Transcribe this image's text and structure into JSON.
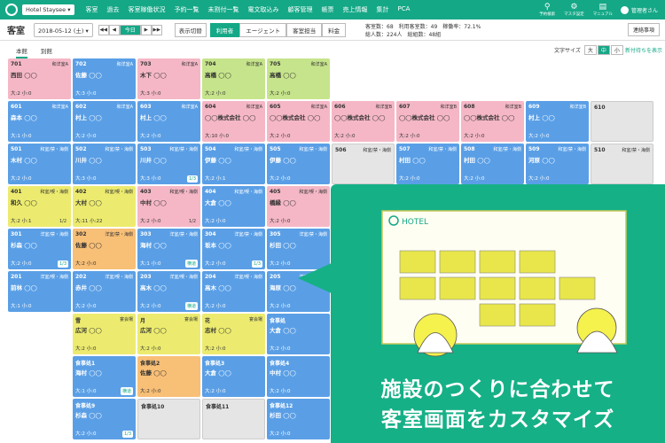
{
  "nav": {
    "hotel": "Hotel Staysee",
    "items": [
      "客室",
      "過去",
      "客室稼働状況",
      "予約一覧",
      "未割付一覧",
      "電文取込み",
      "顧客管理",
      "帳票",
      "売上情報",
      "集計",
      "PCA"
    ],
    "icons": [
      {
        "icon": "search-icon",
        "label": "予約検索"
      },
      {
        "icon": "gear-icon",
        "label": "マスタ設定"
      },
      {
        "icon": "book-icon",
        "label": "マニュアル"
      }
    ],
    "user": "管理者さん"
  },
  "toolbar": {
    "title": "客室",
    "date": "2018-05-12 (土)",
    "prev2": "◀◀",
    "prev": "◀",
    "today": "今日",
    "next": "▶",
    "next2": "▶▶",
    "switch_label": "表示切替",
    "segments": [
      "利用者",
      "エージェント",
      "客室担当",
      "料金"
    ],
    "stats_line1": "客室数：68　利用客室数：49　稼働率：72.1%",
    "stats_line2": "総人数：224人　総組数：48組",
    "contact": "連絡事項"
  },
  "view": {
    "tabs": [
      "本館",
      "別館"
    ],
    "font_label": "文字サイズ",
    "font_sizes": [
      "大",
      "中",
      "小"
    ],
    "new_link": "新付待ちを表示"
  },
  "rows": [
    {
      "y": 0,
      "cells": [
        {
          "c": 0,
          "room": "701",
          "type": "和洋室A",
          "guest": "西田",
          "count": "大:2 小:0",
          "color": "p"
        },
        {
          "c": 1,
          "room": "702",
          "type": "和洋室A",
          "guest": "佐藤",
          "count": "大:3 小:0",
          "color": "b"
        },
        {
          "c": 2,
          "room": "703",
          "type": "和洋室A",
          "guest": "木下",
          "count": "大:3 小:0",
          "color": "p"
        },
        {
          "c": 3,
          "room": "704",
          "type": "和洋室A",
          "guest": "高橋",
          "count": "大:2 小:0",
          "color": "g"
        },
        {
          "c": 4,
          "room": "705",
          "type": "和洋室A",
          "guest": "高橋",
          "count": "大:2 小:0",
          "color": "g"
        }
      ]
    },
    {
      "y": 1,
      "cells": [
        {
          "c": 0,
          "room": "601",
          "type": "和洋室A",
          "guest": "森本",
          "count": "大:1 小:0",
          "color": "b"
        },
        {
          "c": 1,
          "room": "602",
          "type": "和洋室A",
          "guest": "村上",
          "count": "大:2 小:0",
          "color": "b"
        },
        {
          "c": 2,
          "room": "603",
          "type": "和洋室A",
          "guest": "村上",
          "count": "大:2 小:0",
          "color": "b"
        },
        {
          "c": 3,
          "room": "604",
          "type": "和洋室A",
          "guest": "◯◯株式会社",
          "count": "大:10 小:0",
          "color": "p"
        },
        {
          "c": 4,
          "room": "605",
          "type": "和洋室A",
          "guest": "◯◯株式会社",
          "count": "大:2 小:0",
          "color": "p"
        },
        {
          "c": 5,
          "room": "606",
          "type": "和洋室B",
          "guest": "◯◯株式会社",
          "count": "大:2 小:0",
          "color": "p"
        },
        {
          "c": 6,
          "room": "607",
          "type": "和洋室B",
          "guest": "◯◯株式会社",
          "count": "大:2 小:0",
          "color": "p"
        },
        {
          "c": 7,
          "room": "608",
          "type": "和洋室B",
          "guest": "◯◯株式会社",
          "count": "大:2 小:0",
          "color": "p"
        },
        {
          "c": 8,
          "room": "609",
          "type": "和洋室B",
          "guest": "村上",
          "count": "大:2 小:0",
          "color": "b"
        },
        {
          "c": 9,
          "room": "610",
          "type": "",
          "guest": "",
          "count": "",
          "color": "gr"
        }
      ]
    },
    {
      "y": 2,
      "cells": [
        {
          "c": 0,
          "room": "501",
          "type": "和室/禁・海側",
          "guest": "木村",
          "count": "大:2 小:0",
          "color": "b"
        },
        {
          "c": 1,
          "room": "502",
          "type": "和室/禁・海側",
          "guest": "川井",
          "count": "大:3 小:0",
          "color": "b"
        },
        {
          "c": 2,
          "room": "503",
          "type": "和室/禁・海側",
          "guest": "川井",
          "count": "大:3 小:0",
          "color": "b",
          "badge": "1/3"
        },
        {
          "c": 3,
          "room": "504",
          "type": "和室/禁・海側",
          "guest": "伊藤",
          "count": "大:2 小:1",
          "color": "b"
        },
        {
          "c": 4,
          "room": "505",
          "type": "和室/禁・海側",
          "guest": "伊藤",
          "count": "大:2 小:0",
          "color": "b"
        },
        {
          "c": 5,
          "room": "506",
          "type": "和室/禁・海側",
          "guest": "",
          "count": "",
          "color": "gr"
        },
        {
          "c": 6,
          "room": "507",
          "type": "和室/禁・海側",
          "guest": "村田",
          "count": "大:2 小:0",
          "color": "b"
        },
        {
          "c": 7,
          "room": "508",
          "type": "和室/禁・海側",
          "guest": "村田",
          "count": "大:2 小:0",
          "color": "b"
        },
        {
          "c": 8,
          "room": "509",
          "type": "和室/禁・海側",
          "guest": "河原",
          "count": "大:2 小:0",
          "color": "b"
        },
        {
          "c": 9,
          "room": "510",
          "type": "和室/禁・海側",
          "guest": "",
          "count": "",
          "color": "gr"
        }
      ]
    },
    {
      "y": 3,
      "cells": [
        {
          "c": 0,
          "room": "401",
          "type": "和室/喫・海側",
          "guest": "和久",
          "count": "大:2 小:1",
          "color": "y",
          "badge": "1/2"
        },
        {
          "c": 1,
          "room": "402",
          "type": "和室/喫・海側",
          "guest": "大村",
          "count": "大:11 小:22",
          "color": "y"
        },
        {
          "c": 2,
          "room": "403",
          "type": "和室/喫・海側",
          "guest": "中村",
          "count": "大:2 小:0",
          "color": "p",
          "badge": "1/2"
        },
        {
          "c": 3,
          "room": "404",
          "type": "和室/喫・海側",
          "guest": "大倉",
          "count": "大:2 小:0",
          "color": "b"
        },
        {
          "c": 4,
          "room": "405",
          "type": "和室/喫・海側",
          "guest": "橋縁",
          "count": "大:2 小:0",
          "color": "p"
        }
      ]
    },
    {
      "y": 4,
      "cells": [
        {
          "c": 0,
          "room": "301",
          "type": "洋室/禁・海側",
          "guest": "杉森",
          "count": "大:2 小:0",
          "color": "b",
          "badge": "1/3"
        },
        {
          "c": 1,
          "room": "302",
          "type": "洋室/禁・海側",
          "guest": "佐藤",
          "count": "大:2 小:0",
          "color": "o"
        },
        {
          "c": 2,
          "room": "303",
          "type": "洋室/禁・海側",
          "guest": "海村",
          "count": "大:1 小:0",
          "color": "b",
          "badge": "横道"
        },
        {
          "c": 3,
          "room": "304",
          "type": "洋室/禁・海側",
          "guest": "坂本",
          "count": "大:2 小:0",
          "color": "b",
          "badge": "1/3"
        },
        {
          "c": 4,
          "room": "305",
          "type": "洋室/禁・海側",
          "guest": "杉田",
          "count": "大:2 小:0",
          "color": "b"
        }
      ]
    },
    {
      "y": 5,
      "cells": [
        {
          "c": 0,
          "room": "201",
          "type": "洋室/喫・海側",
          "guest": "前林",
          "count": "大:1 小:0",
          "color": "b"
        },
        {
          "c": 1,
          "room": "202",
          "type": "洋室/喫・海側",
          "guest": "赤井",
          "count": "大:2 小:0",
          "color": "b"
        },
        {
          "c": 2,
          "room": "203",
          "type": "洋室/喫・海側",
          "guest": "高木",
          "count": "大:2 小:0",
          "color": "b",
          "badge": "横道"
        },
        {
          "c": 3,
          "room": "204",
          "type": "洋室/喫・海側",
          "guest": "高木",
          "count": "大:2 小:0",
          "color": "b"
        },
        {
          "c": 4,
          "room": "205",
          "type": "洋室/喫・海側",
          "guest": "海原",
          "count": "大:2 小:0",
          "color": "b"
        }
      ]
    },
    {
      "y": 6,
      "cells": [
        {
          "c": 1,
          "room": "雪",
          "type": "宴会場",
          "guest": "広河",
          "count": "大:2 小:0",
          "color": "y"
        },
        {
          "c": 2,
          "room": "月",
          "type": "宴会場",
          "guest": "広河",
          "count": "大:2 小:0",
          "color": "y"
        },
        {
          "c": 3,
          "room": "花",
          "type": "宴会場",
          "guest": "志村",
          "count": "大:2 小:0",
          "color": "y"
        },
        {
          "c": 4,
          "room": "食事処",
          "type": "",
          "guest": "大倉",
          "count": "大:2 小:0",
          "color": "b"
        }
      ]
    },
    {
      "y": 7,
      "cells": [
        {
          "c": 1,
          "room": "食事処1",
          "type": "",
          "guest": "海村",
          "count": "大:1 小:0",
          "color": "b",
          "badge": "横道"
        },
        {
          "c": 2,
          "room": "食事処2",
          "type": "",
          "guest": "佐藤",
          "count": "大:2 小:0",
          "color": "o"
        },
        {
          "c": 3,
          "room": "食事処3",
          "type": "",
          "guest": "大倉",
          "count": "大:2 小:0",
          "color": "b"
        },
        {
          "c": 4,
          "room": "食事処4",
          "type": "",
          "guest": "中村",
          "count": "大:2 小:0",
          "color": "b"
        }
      ]
    },
    {
      "y": 8,
      "cells": [
        {
          "c": 1,
          "room": "食事処9",
          "type": "",
          "guest": "杉森",
          "count": "大:2 小:0",
          "color": "b",
          "badge": "1/3"
        },
        {
          "c": 2,
          "room": "食事処10",
          "type": "",
          "guest": "",
          "count": "",
          "color": "gr"
        },
        {
          "c": 3,
          "room": "食事処11",
          "type": "",
          "guest": "",
          "count": "",
          "color": "gr"
        },
        {
          "c": 4,
          "room": "食事処12",
          "type": "",
          "guest": "杉田",
          "count": "大:2 小:0",
          "color": "b"
        }
      ]
    }
  ],
  "promo": {
    "line1": "施設のつくりに合わせて",
    "line2": "客室画面をカスタマイズ",
    "illus_hotel": "HOTEL"
  }
}
